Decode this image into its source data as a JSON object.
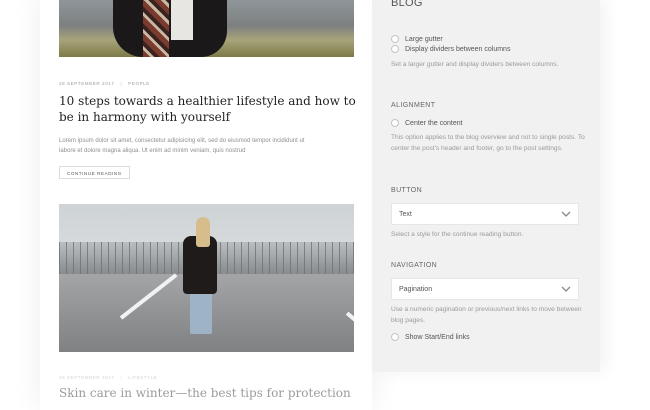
{
  "posts": [
    {
      "title": "10 steps towards a healthier lifestyle and how to be in harmony with yourself",
      "date": "28 September 2017",
      "category": "People",
      "excerpt": "Lorem ipsum dolor sit amet, consectetur adipisicing elit, sed do eiusmod tempor incididunt ut labore et dolore magna aliqua. Ut enim ad minim veniam, quis nostrud",
      "read_more_label": "Continue reading"
    },
    {
      "title": "Skin care in winter—the best tips for protection",
      "date": "28 September 2017",
      "category": "Lifestyle"
    }
  ],
  "panel": {
    "title": "BLOG",
    "layout": {
      "options": [
        "Large gutter",
        "Display dividers between columns"
      ],
      "help": "Set a larger gutter and display dividers between columns."
    },
    "alignment": {
      "title": "ALIGNMENT",
      "option": "Center the content",
      "help": "This option applies to the blog overview and not to single posts. To center the post's header and footer, go to the post settings."
    },
    "button": {
      "title": "BUTTON",
      "selected": "Text",
      "help": "Select a style for the continue reading button."
    },
    "navigation": {
      "title": "NAVIGATION",
      "selected": "Pagination",
      "help": "Use a numeric pagination or previous/next links to move between blog pages.",
      "option": "Show Start/End links"
    }
  }
}
